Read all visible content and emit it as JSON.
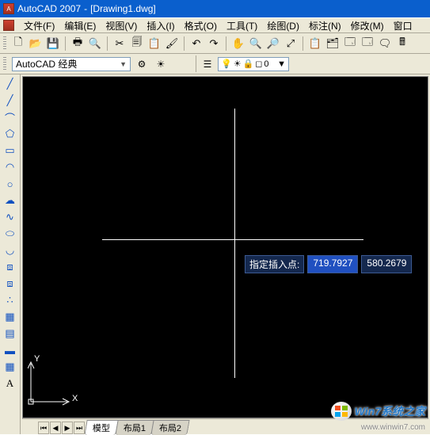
{
  "titlebar": {
    "app": "AutoCAD 2007",
    "doc": "[Drawing1.dwg]"
  },
  "menu": {
    "file": "文件(F)",
    "edit": "编辑(E)",
    "view": "视图(V)",
    "insert": "插入(I)",
    "format": "格式(O)",
    "tools": "工具(T)",
    "draw": "绘图(D)",
    "dim": "标注(N)",
    "modify": "修改(M)",
    "window": "窗口"
  },
  "workspace": {
    "name": "AutoCAD 经典",
    "layer0": "0"
  },
  "prompt": {
    "label": "指定插入点:",
    "x": "719.7927",
    "y": "580.2679"
  },
  "ucs": {
    "xlabel": "X",
    "ylabel": "Y"
  },
  "tabs": {
    "model": "模型",
    "layout1": "布局1",
    "layout2": "布局2"
  },
  "watermark": {
    "text": "Win7系统之家",
    "url": "www.winwin7.com"
  },
  "icons": {
    "new": "🗋",
    "open": "📂",
    "save": "💾",
    "plot": "🖶",
    "preview": "🔍",
    "cut": "✂",
    "copy": "🗐",
    "paste": "📋",
    "match": "🖌",
    "undo": "↶",
    "redo": "↷",
    "pan": "✋",
    "zoomr": "🔍",
    "zoomw": "🔎",
    "zoomp": "⤢",
    "prop": "📋",
    "dc": "🗂",
    "tp": "🗔",
    "tp2": "🗔",
    "markup": "🗨",
    "calc": "🖩",
    "help": "?",
    "ws1": "⚙",
    "ws2": "☀",
    "layers": "☰",
    "bulb": "💡",
    "sun": "☀",
    "lock": "🔒",
    "color": "◻",
    "line": "╱",
    "cline": "╱",
    "pline": "⌒",
    "poly": "⬠",
    "rect": "▭",
    "arc": "◠",
    "circ": "○",
    "cloud": "☁",
    "spline": "∿",
    "ellipse": "⬭",
    "earc": "◡",
    "block": "⧈",
    "point": "∴",
    "hatch": "▦",
    "grad": "▤",
    "region": "▬",
    "table": "▦",
    "text": "A"
  }
}
